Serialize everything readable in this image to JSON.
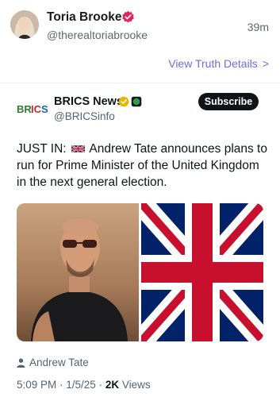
{
  "header": {
    "name": "Toria Brooke",
    "handle": "@therealtoriabrooke",
    "time": "39m"
  },
  "view_details": {
    "label": "View Truth Details",
    "chevron": ">"
  },
  "embedded_post": {
    "logo_text": "BRICS",
    "source_name": "BRICS News",
    "source_handle": "@BRICSinfo",
    "subscribe_label": "Subscribe",
    "text_before_flag": "JUST IN:",
    "text_after_flag": "Andrew Tate announces plans to run for Prime Minister of the United Kingdom in the next general election.",
    "tagged_person": "Andrew Tate",
    "time": "5:09 PM",
    "date": "1/5/25",
    "views_count": "2K",
    "views_label": "Views"
  },
  "colors": {
    "verified_pink": "#e0245e",
    "link_purple": "#6b6ee0",
    "text_dark": "#0f1419",
    "text_gray": "#536471",
    "union_blue": "#012169",
    "union_red": "#c8102e"
  },
  "icons": {
    "verified": "verified-badge-icon",
    "chevron": "chevron-right-icon",
    "person": "person-icon",
    "flag": "union-jack-flag-icon"
  }
}
